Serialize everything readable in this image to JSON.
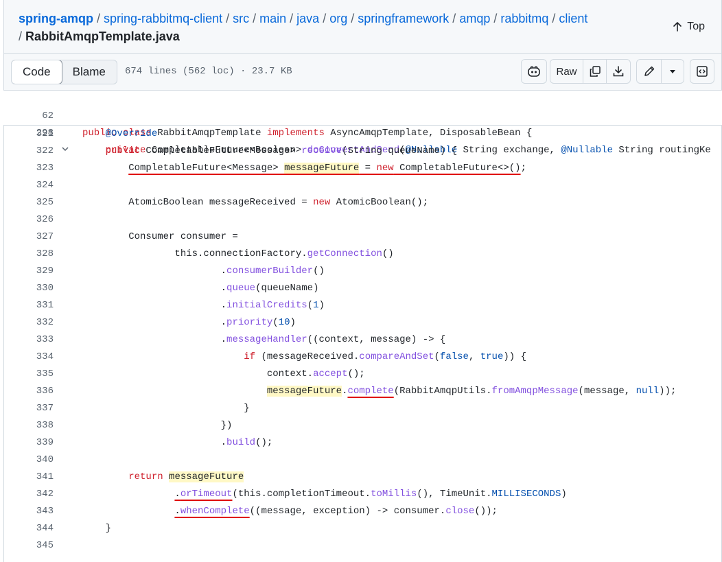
{
  "breadcrumb": {
    "segments": [
      "spring-amqp",
      "spring-rabbitmq-client",
      "src",
      "main",
      "java",
      "org",
      "springframework",
      "amqp",
      "rabbitmq",
      "client"
    ],
    "file": "RabbitAmqpTemplate.java",
    "separator": "/"
  },
  "top_button": {
    "label": "Top"
  },
  "toolbar": {
    "code_tab": "Code",
    "blame_tab": "Blame",
    "file_info": "674 lines (562 loc) · 23.7 KB",
    "raw_label": "Raw"
  },
  "sticky": [
    {
      "num": "62",
      "text": "public class RabbitAmqpTemplate implements AsyncAmqpTemplate, DisposableBean {"
    },
    {
      "num": "298",
      "text": "    private CompletableFuture<Boolean> doConvertAndSend(@Nullable String exchange, @Nullable String routingKe"
    }
  ],
  "lines": [
    {
      "num": "321",
      "text": "    @Override"
    },
    {
      "num": "322",
      "text": "    public CompletableFuture<Message> receive(String queueName) {"
    },
    {
      "num": "323",
      "text": "        CompletableFuture<Message> messageFuture = new CompletableFuture<>();"
    },
    {
      "num": "324",
      "text": ""
    },
    {
      "num": "325",
      "text": "        AtomicBoolean messageReceived = new AtomicBoolean();"
    },
    {
      "num": "326",
      "text": ""
    },
    {
      "num": "327",
      "text": "        Consumer consumer ="
    },
    {
      "num": "328",
      "text": "                this.connectionFactory.getConnection()"
    },
    {
      "num": "329",
      "text": "                        .consumerBuilder()"
    },
    {
      "num": "330",
      "text": "                        .queue(queueName)"
    },
    {
      "num": "331",
      "text": "                        .initialCredits(1)"
    },
    {
      "num": "332",
      "text": "                        .priority(10)"
    },
    {
      "num": "333",
      "text": "                        .messageHandler((context, message) -> {"
    },
    {
      "num": "334",
      "text": "                            if (messageReceived.compareAndSet(false, true)) {"
    },
    {
      "num": "335",
      "text": "                                context.accept();"
    },
    {
      "num": "336",
      "text": "                                messageFuture.complete(RabbitAmqpUtils.fromAmqpMessage(message, null));"
    },
    {
      "num": "337",
      "text": "                            }"
    },
    {
      "num": "338",
      "text": "                        })"
    },
    {
      "num": "339",
      "text": "                        .build();"
    },
    {
      "num": "340",
      "text": ""
    },
    {
      "num": "341",
      "text": "        return messageFuture"
    },
    {
      "num": "342",
      "text": "                .orTimeout(this.completionTimeout.toMillis(), TimeUnit.MILLISECONDS)"
    },
    {
      "num": "343",
      "text": "                .whenComplete((message, exception) -> consumer.close());"
    },
    {
      "num": "344",
      "text": "    }"
    },
    {
      "num": "345",
      "text": ""
    }
  ],
  "colors": {
    "link": "#0969da",
    "keyword": "#cf222e",
    "function": "#8250df",
    "constant": "#0550ae",
    "highlight": "#fff8c5",
    "annotation_underline": "#e00000"
  }
}
